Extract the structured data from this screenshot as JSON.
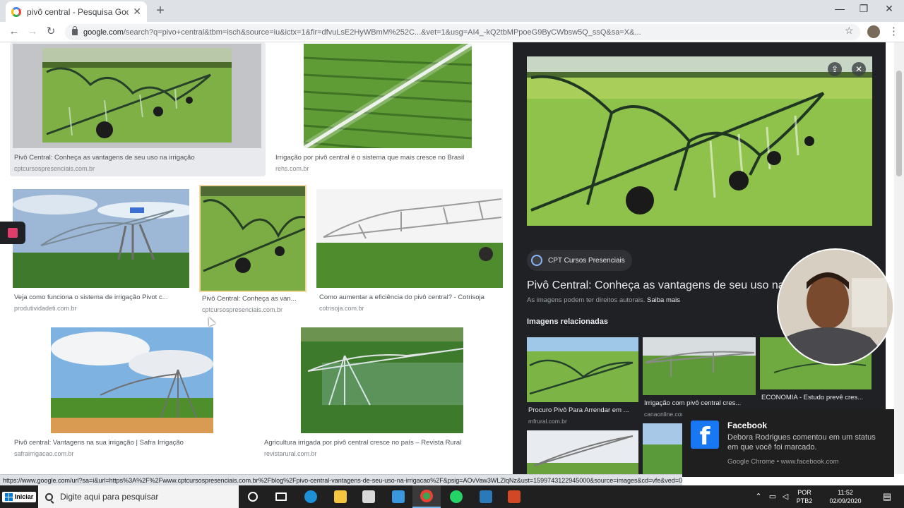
{
  "browser": {
    "tab_title": "pivô central - Pesquisa Google",
    "url_domain": "google.com",
    "url_rest": "/search?q=pivo+central&tbm=isch&source=iu&ictx=1&fir=dfvuLsE2HyWBmM%252C...&vet=1&usg=AI4_-kQ2tbMPpoeG9ByCWbsw5Q_ssQ&sa=X&..."
  },
  "results": [
    {
      "caption": "Pivô Central: Conheça as vantagens de seu uso na irrigação",
      "source": "cptcursospresenciais.com.br"
    },
    {
      "caption": "Irrigação por pivô central é o sistema que mais cresce no Brasil",
      "source": "rehs.com.br"
    },
    {
      "caption": "Veja como funciona o sistema de irrigação Pivot c...",
      "source": "produtividadeti.com.br"
    },
    {
      "caption": "Pivô Central: Conheça as van...",
      "source": "cptcursospresenciais.com.br"
    },
    {
      "caption": "Como aumentar a eficiência do pivô central? - Cotrisoja",
      "source": "cotrisoja.com.br"
    },
    {
      "caption": "Pivô central: Vantagens na sua irrigação | Safra Irrigação",
      "source": "safrairrigacao.com.br"
    },
    {
      "caption": "Agricultura irrigada por pivô central cresce no país – Revista Rural",
      "source": "revistarural.com.br"
    }
  ],
  "panel": {
    "source_name": "CPT Cursos Presenciais",
    "title": "Pivô Central: Conheça as vantagens de seu uso na irrigação",
    "rights_text": "As imagens podem ter direitos autorais.",
    "rights_link": "Saiba mais",
    "related_heading": "Imagens relacionadas",
    "related": [
      {
        "caption": "Procuro Pivô Para Arrendar em ...",
        "source": "mfrural.com.br"
      },
      {
        "caption": "Irrigação com pivô central cres...",
        "source": "canaonline.com.br"
      },
      {
        "caption": "ECONOMIA - Estudo prevê cres...",
        "source": ""
      }
    ]
  },
  "notification": {
    "title": "Facebook",
    "body": "Debora Rodrigues comentou em um status em que você foi marcado.",
    "meta": "Google Chrome • www.facebook.com"
  },
  "status_url": "https://www.google.com/url?sa=i&url=https%3A%2F%2Fwww.cptcursospresenciais.com.br%2Fblog%2Fpivo-central-vantagens-de-seu-uso-na-irrigacao%2F&psig=AOvVaw3WLZlqNz&ust=1599743122945000&source=images&cd=vfe&ved=0CAIQjRxqFwoTCJig",
  "taskbar": {
    "start_label": "Iniciar",
    "search_placeholder": "Digite aqui para pesquisar",
    "lang_top": "POR",
    "lang_bottom": "PTB2",
    "time": "11:52",
    "date": "02/09/2020"
  },
  "colors": {
    "panel_bg": "#202124",
    "grid_selected": "#e8eaed",
    "facebook": "#1877f2",
    "taskbar": "#202020"
  }
}
